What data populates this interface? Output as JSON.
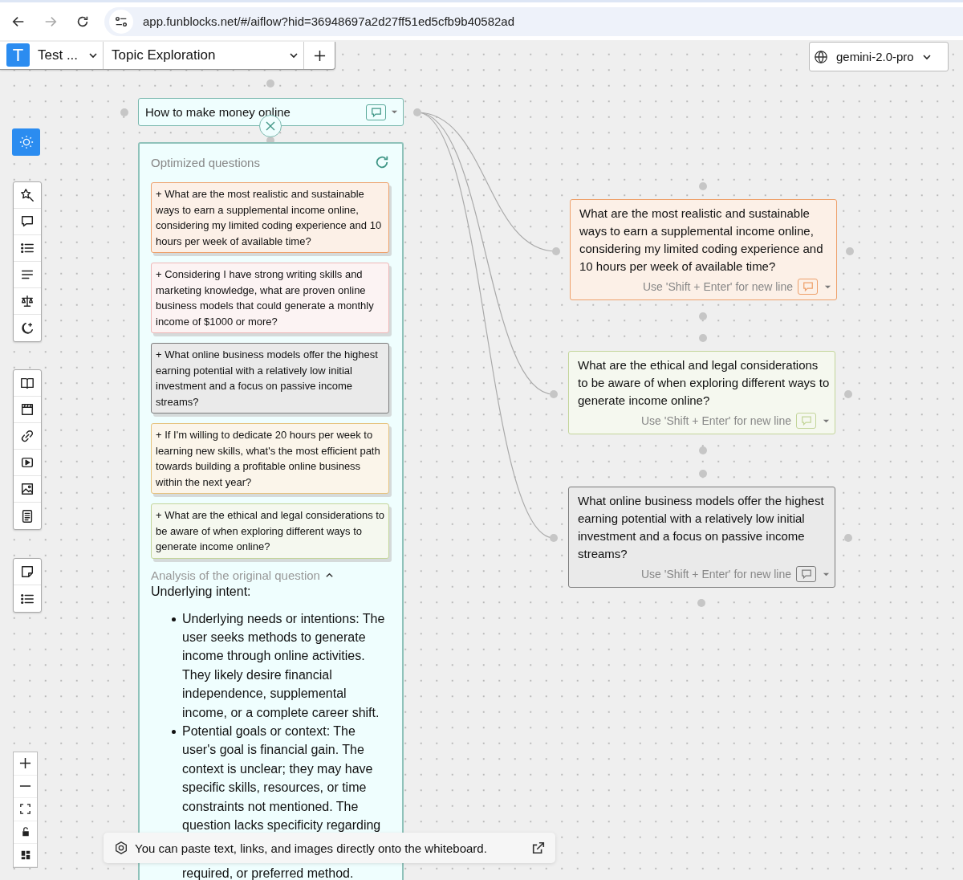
{
  "browser": {
    "url": "app.funblocks.net/#/aiflow?hid=36948697a2d27ff51ed5cfb9b40582ad"
  },
  "toolbar": {
    "logo": "T",
    "workspace": "Test ...",
    "board": "Topic Exploration"
  },
  "model": "gemini-2.0-pro",
  "root_node": {
    "title": "How to make money online"
  },
  "panel": {
    "title": "Optimized questions",
    "questions": [
      {
        "text": "+ What are the most realistic and sustainable ways to earn a supplemental income online, considering my limited coding experience and 10 hours per week of available time?",
        "color": "#eea06a"
      },
      {
        "text": "+ Considering I have strong writing skills and marketing knowledge, what are proven online business models that could generate a monthly income of $1000 or more?",
        "color": "#efb7b7"
      },
      {
        "text": "+ What online business models offer the highest earning potential with a relatively low initial investment and a focus on passive income streams?",
        "color": "#7c7c7c"
      },
      {
        "text": "+ If I'm willing to dedicate 20 hours per week to learning new skills, what's the most efficient path towards building a profitable online business within the next year?",
        "color": "#e6c27c"
      },
      {
        "text": "+ What are the ethical and legal considerations to be aware of when exploring different ways to generate income online?",
        "color": "#c3d59a"
      }
    ],
    "analysis_title": "Analysis of the original question",
    "analysis_expanded": true,
    "intent_heading": "Underlying intent:",
    "bullets": [
      "Underlying needs or intentions: The user seeks methods to generate income through online activities. They likely desire financial independence, supplemental income, or a complete career shift.",
      "Potential goals or context: The user's goal is financial gain. The context is unclear; they may have specific skills, resources, or time constraints not mentioned. The question lacks specificity regarding"
    ],
    "bullet_tail": "required, or preferred method."
  },
  "nodes": [
    {
      "text": "What are the most realistic and sustainable ways to earn a supplemental income online, considering my limited coding experience and 10 hours per week of available time?",
      "hint": "Use 'Shift + Enter' for new line",
      "color": "#eea06a"
    },
    {
      "text": "What are the ethical and legal considerations to be aware of when exploring different ways to generate income online?",
      "hint": "Use 'Shift + Enter' for new line",
      "color": "#c3d59a"
    },
    {
      "text": "What online business models offer the highest earning potential with a relatively low initial investment and a focus on passive income streams?",
      "hint": "Use 'Shift + Enter' for new line",
      "color": "#7c7c7c"
    }
  ],
  "toast": {
    "text": "You can paste text, links, and images directly onto the whiteboard."
  }
}
